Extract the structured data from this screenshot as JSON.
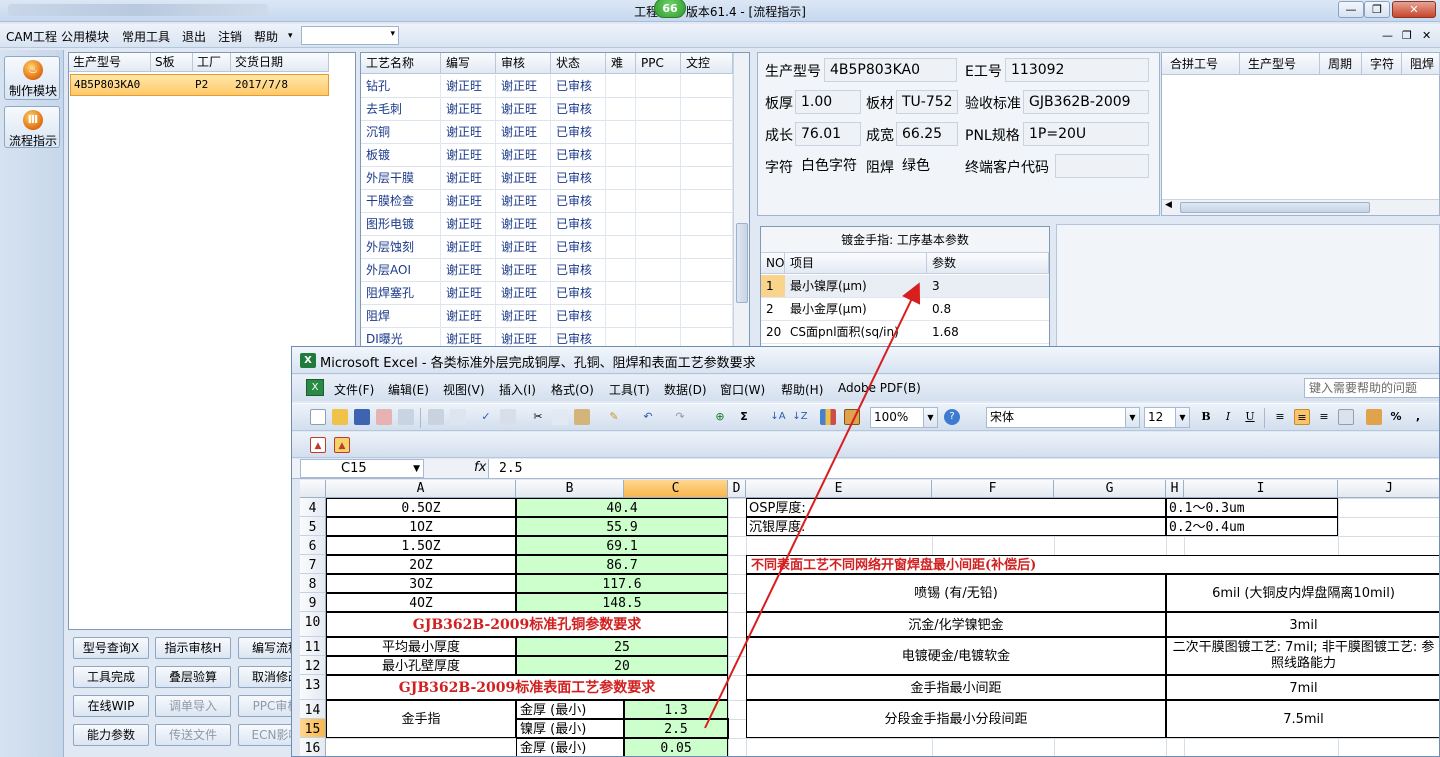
{
  "app": {
    "title": "工程系统   版本61.4 - [流程指示]",
    "badge": "66",
    "win_controls": [
      "—",
      "❐",
      "✕"
    ]
  },
  "menubar": {
    "items": [
      "CAM工程",
      "公用模块",
      "常用工具",
      "退出",
      "注销",
      "帮助"
    ],
    "help_arrow": "▾",
    "combo_arrow": "▾",
    "mdi_controls": [
      "—",
      "❐",
      "✕"
    ]
  },
  "leftnav": {
    "buttons": [
      {
        "label": "制作模块",
        "icon_name": "flame-icon"
      },
      {
        "label": "流程指示",
        "icon_name": "flow-icon"
      }
    ]
  },
  "job_list": {
    "headers": [
      "生产型号",
      "S板",
      "工厂",
      "交货日期"
    ],
    "row": {
      "model": "4B5P803KA0",
      "sboard": "",
      "factory": "P2",
      "date": "2017/7/8"
    }
  },
  "button_grid": {
    "rows": [
      [
        {
          "label": "型号查询X",
          "enabled": true
        },
        {
          "label": "指示审核H",
          "enabled": true
        },
        {
          "label": "编写流程",
          "enabled": true
        }
      ],
      [
        {
          "label": "工具完成",
          "enabled": true
        },
        {
          "label": "叠层验算",
          "enabled": true
        },
        {
          "label": "取消修改",
          "enabled": true
        }
      ],
      [
        {
          "label": "在线WIP",
          "enabled": true
        },
        {
          "label": "调单导入",
          "enabled": false
        },
        {
          "label": "PPC审核",
          "enabled": false
        }
      ],
      [
        {
          "label": "能力参数",
          "enabled": true
        },
        {
          "label": "传送文件",
          "enabled": false
        },
        {
          "label": "ECN影响",
          "enabled": false
        }
      ]
    ]
  },
  "process_grid": {
    "headers": [
      "工艺名称",
      "编写",
      "审核",
      "状态",
      "难",
      "PPC",
      "文控"
    ],
    "rows": [
      [
        "钻孔",
        "谢正旺",
        "谢正旺",
        "已审核"
      ],
      [
        "去毛刺",
        "谢正旺",
        "谢正旺",
        "已审核"
      ],
      [
        "沉铜",
        "谢正旺",
        "谢正旺",
        "已审核"
      ],
      [
        "板镀",
        "谢正旺",
        "谢正旺",
        "已审核"
      ],
      [
        "外层干膜",
        "谢正旺",
        "谢正旺",
        "已审核"
      ],
      [
        "干膜检查",
        "谢正旺",
        "谢正旺",
        "已审核"
      ],
      [
        "图形电镀",
        "谢正旺",
        "谢正旺",
        "已审核"
      ],
      [
        "外层蚀刻",
        "谢正旺",
        "谢正旺",
        "已审核"
      ],
      [
        "外层AOI",
        "谢正旺",
        "谢正旺",
        "已审核"
      ],
      [
        "阻焊塞孔",
        "谢正旺",
        "谢正旺",
        "已审核"
      ],
      [
        "阻焊",
        "谢正旺",
        "谢正旺",
        "已审核"
      ],
      [
        "DI曝光",
        "谢正旺",
        "谢正旺",
        "已审核"
      ]
    ]
  },
  "info": {
    "model_label": "生产型号",
    "model": "4B5P803KA0",
    "eno_label": "E工号",
    "eno": "113092",
    "thickness_label": "板厚",
    "thickness": "1.00",
    "material_label": "板材",
    "material": "TU-752",
    "standard_label": "验收标准",
    "standard": "GJB362B-2009",
    "length_label": "成长",
    "length": "76.01",
    "width_label": "成宽",
    "width": "66.25",
    "pnl_label": "PNL规格",
    "pnl": "1P=20U",
    "char_label": "字符",
    "char": "白色字符",
    "solder_label": "阻焊",
    "solder": "绿色",
    "customer_label": "终端客户代码",
    "customer": ""
  },
  "combine_grid": {
    "headers": [
      "合拼工号",
      "生产型号",
      "周期",
      "字符",
      "阻焊"
    ]
  },
  "param_panel": {
    "title": "镀金手指: 工序基本参数",
    "headers": [
      "NO",
      "项目",
      "参数"
    ],
    "rows": [
      {
        "no": "1",
        "item": "最小镍厚(μm)",
        "value": "3"
      },
      {
        "no": "2",
        "item": "最小金厚(μm)",
        "value": "0.8"
      },
      {
        "no": "20",
        "item": "CS面pnl面积(sq/in)",
        "value": "1.68"
      }
    ]
  },
  "excel": {
    "title": "Microsoft Excel - 各类标准外层完成铜厚、孔铜、阻焊和表面工艺参数要求",
    "logo": "X",
    "menu": [
      "文件(F)",
      "编辑(E)",
      "视图(V)",
      "插入(I)",
      "格式(O)",
      "工具(T)",
      "数据(D)",
      "窗口(W)",
      "帮助(H)",
      "Adobe PDF(B)"
    ],
    "help_placeholder": "键入需要帮助的问题",
    "toolbar": {
      "zoom": "100%",
      "font": "宋体",
      "font_size": "12",
      "sigma": "Σ",
      "bold": "B",
      "italic": "I",
      "underline": "U",
      "percent": "%",
      "comma": ","
    },
    "name_box": "C15",
    "fx": "fx",
    "formula_value": "2.5",
    "columns": [
      "A",
      "B",
      "C",
      "D",
      "E",
      "F",
      "G",
      "H",
      "I",
      "J"
    ],
    "row_numbers": [
      "4",
      "5",
      "6",
      "7",
      "8",
      "9",
      "10",
      "11",
      "12",
      "13",
      "14",
      "15",
      "16"
    ],
    "copper_rows": [
      {
        "a": "0.5OZ",
        "b": "40.4"
      },
      {
        "a": "1OZ",
        "b": "55.9"
      },
      {
        "a": "1.5OZ",
        "b": "69.1"
      },
      {
        "a": "2OZ",
        "b": "86.7"
      },
      {
        "a": "3OZ",
        "b": "117.6"
      },
      {
        "a": "4OZ",
        "b": "148.5"
      }
    ],
    "hole_title": "GJB362B-2009标准孔铜参数要求",
    "hole_rows": [
      {
        "a": "平均最小厚度",
        "b": "25"
      },
      {
        "a": "最小孔壁厚度",
        "b": "20"
      }
    ],
    "surface_title": "GJB362B-2009标准表面工艺参数要求",
    "gold_label": "金手指",
    "gold_rows": [
      {
        "b": "金厚 (最小)",
        "c": "1.3"
      },
      {
        "b": "镍厚 (最小)",
        "c": "2.5"
      },
      {
        "b": "金厚 (最小)",
        "c": "0.05"
      }
    ],
    "right_top": [
      {
        "e": "OSP厚度:",
        "g": "0.1～0.3um"
      },
      {
        "e": "沉银厚度:",
        "g": "0.2～0.4um"
      }
    ],
    "spacing_title": "不同表面工艺不同网络开窗焊盘最小间距(补偿后)",
    "spacing_rows": [
      {
        "process": "喷锡 (有/无铅)",
        "value": "6mil (大铜皮内焊盘隔离10mil)"
      },
      {
        "process": "沉金/化学镍钯金",
        "value": "3mil"
      },
      {
        "process": "电镀硬金/电镀软金",
        "value": "二次干膜图镀工艺: 7mil; 非干膜图镀工艺: 参照线路能力"
      },
      {
        "process": "金手指最小间距",
        "value": "7mil"
      },
      {
        "process": "分段金手指最小分段间距",
        "value": "7.5mil"
      }
    ]
  },
  "annotation": {
    "arrow_color": "#d81e1e"
  }
}
